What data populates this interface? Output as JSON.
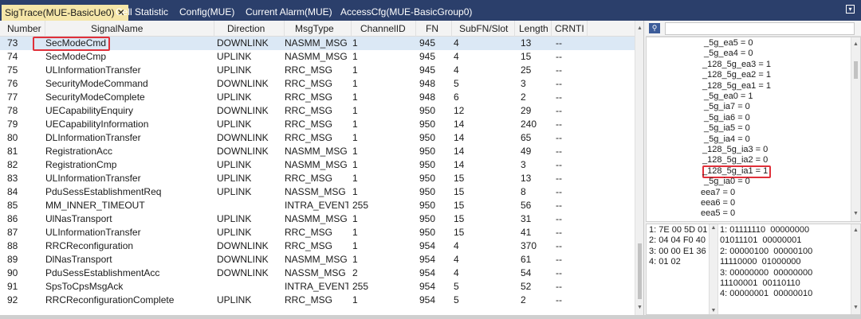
{
  "tabs": [
    {
      "label": "SigTrace(MUE-BasicUe0)",
      "close": "✕",
      "active": true
    },
    {
      "label": "Cell Statistic"
    },
    {
      "label": "Config(MUE)"
    },
    {
      "label": "Current Alarm(MUE)"
    },
    {
      "label": "AccessCfg(MUE-BasicGroup0)"
    }
  ],
  "tab_menu_icon": "▾",
  "table": {
    "columns": [
      "Number",
      "SignalName",
      "Direction",
      "MsgType",
      "ChannelID",
      "FN",
      "SubFN/Slot",
      "Length",
      "CRNTI"
    ],
    "rows": [
      {
        "num": "73",
        "sig": "SecModeCmd",
        "dir": "DOWNLINK",
        "msg": "NASMM_MSG",
        "ch": "1",
        "fn": "945",
        "sub": "4",
        "len": "13",
        "crnti": "--"
      },
      {
        "num": "74",
        "sig": "SecModeCmp",
        "dir": "UPLINK",
        "msg": "NASMM_MSG",
        "ch": "1",
        "fn": "945",
        "sub": "4",
        "len": "15",
        "crnti": "--"
      },
      {
        "num": "75",
        "sig": "ULInformationTransfer",
        "dir": "UPLINK",
        "msg": "RRC_MSG",
        "ch": "1",
        "fn": "945",
        "sub": "4",
        "len": "25",
        "crnti": "--"
      },
      {
        "num": "76",
        "sig": "SecurityModeCommand",
        "dir": "DOWNLINK",
        "msg": "RRC_MSG",
        "ch": "1",
        "fn": "948",
        "sub": "5",
        "len": "3",
        "crnti": "--"
      },
      {
        "num": "77",
        "sig": "SecurityModeComplete",
        "dir": "UPLINK",
        "msg": "RRC_MSG",
        "ch": "1",
        "fn": "948",
        "sub": "6",
        "len": "2",
        "crnti": "--"
      },
      {
        "num": "78",
        "sig": "UECapabilityEnquiry",
        "dir": "DOWNLINK",
        "msg": "RRC_MSG",
        "ch": "1",
        "fn": "950",
        "sub": "12",
        "len": "29",
        "crnti": "--"
      },
      {
        "num": "79",
        "sig": "UECapabilityInformation",
        "dir": "UPLINK",
        "msg": "RRC_MSG",
        "ch": "1",
        "fn": "950",
        "sub": "14",
        "len": "240",
        "crnti": "--"
      },
      {
        "num": "80",
        "sig": "DLInformationTransfer",
        "dir": "DOWNLINK",
        "msg": "RRC_MSG",
        "ch": "1",
        "fn": "950",
        "sub": "14",
        "len": "65",
        "crnti": "--"
      },
      {
        "num": "81",
        "sig": "RegistrationAcc",
        "dir": "DOWNLINK",
        "msg": "NASMM_MSG",
        "ch": "1",
        "fn": "950",
        "sub": "14",
        "len": "49",
        "crnti": "--"
      },
      {
        "num": "82",
        "sig": "RegistrationCmp",
        "dir": "UPLINK",
        "msg": "NASMM_MSG",
        "ch": "1",
        "fn": "950",
        "sub": "14",
        "len": "3",
        "crnti": "--"
      },
      {
        "num": "83",
        "sig": "ULInformationTransfer",
        "dir": "UPLINK",
        "msg": "RRC_MSG",
        "ch": "1",
        "fn": "950",
        "sub": "15",
        "len": "13",
        "crnti": "--"
      },
      {
        "num": "84",
        "sig": "PduSessEstablishmentReq",
        "dir": "UPLINK",
        "msg": "NASSM_MSG",
        "ch": "1",
        "fn": "950",
        "sub": "15",
        "len": "8",
        "crnti": "--"
      },
      {
        "num": "85",
        "sig": "MM_INNER_TIMEOUT",
        "dir": "",
        "msg": "INTRA_EVENT_I",
        "ch": "255",
        "fn": "950",
        "sub": "15",
        "len": "56",
        "crnti": "--"
      },
      {
        "num": "86",
        "sig": "UlNasTransport",
        "dir": "UPLINK",
        "msg": "NASMM_MSG",
        "ch": "1",
        "fn": "950",
        "sub": "15",
        "len": "31",
        "crnti": "--"
      },
      {
        "num": "87",
        "sig": "ULInformationTransfer",
        "dir": "UPLINK",
        "msg": "RRC_MSG",
        "ch": "1",
        "fn": "950",
        "sub": "15",
        "len": "41",
        "crnti": "--"
      },
      {
        "num": "88",
        "sig": "RRCReconfiguration",
        "dir": "DOWNLINK",
        "msg": "RRC_MSG",
        "ch": "1",
        "fn": "954",
        "sub": "4",
        "len": "370",
        "crnti": "--"
      },
      {
        "num": "89",
        "sig": "DlNasTransport",
        "dir": "DOWNLINK",
        "msg": "NASMM_MSG",
        "ch": "1",
        "fn": "954",
        "sub": "4",
        "len": "61",
        "crnti": "--"
      },
      {
        "num": "90",
        "sig": "PduSessEstablishmentAcc",
        "dir": "DOWNLINK",
        "msg": "NASSM_MSG",
        "ch": "2",
        "fn": "954",
        "sub": "4",
        "len": "54",
        "crnti": "--"
      },
      {
        "num": "91",
        "sig": "SpsToCpsMsgAck",
        "dir": "",
        "msg": "INTRA_EVENT_I",
        "ch": "255",
        "fn": "954",
        "sub": "5",
        "len": "52",
        "crnti": "--"
      },
      {
        "num": "92",
        "sig": "RRCReconfigurationComplete",
        "dir": "UPLINK",
        "msg": "RRC_MSG",
        "ch": "1",
        "fn": "954",
        "sub": "5",
        "len": "2",
        "crnti": "--"
      }
    ]
  },
  "search": {
    "icon": "search-icon",
    "glyph": "⚲",
    "value": ""
  },
  "tree_lines": [
    "_5g_ea5 = 0",
    "_5g_ea4 = 0",
    "_128_5g_ea3 = 1",
    "_128_5g_ea2 = 1",
    "_128_5g_ea1 = 1",
    "_5g_ea0 = 1",
    "_5g_ia7 = 0",
    "_5g_ia6 = 0",
    "_5g_ia5 = 0",
    "_5g_ia4 = 0",
    "_128_5g_ia3 = 0",
    "_128_5g_ia2 = 0",
    "_128_5g_ia1 = 1",
    "_5g_ia0 = 0",
    "eea7 = 0",
    "eea6 = 0",
    "eea5 = 0"
  ],
  "hex_left": [
    "1: 7E 00 5D 01",
    "2: 04 04 F0 40",
    "3: 00 00 E1 36",
    "4: 01 02"
  ],
  "hex_right": [
    "1: 01111110  00000000",
    "01011101  00000001",
    "2: 00000100  00000100",
    "11110000  01000000",
    "3: 00000000  00000000",
    "11100001  00110110",
    "4: 00000001  00000010"
  ],
  "colors": {
    "tab_bar": "#2b3f6b",
    "active_tab": "#f5e6a8",
    "highlight": "#e0303a",
    "selected_row": "#dbe8f5"
  }
}
